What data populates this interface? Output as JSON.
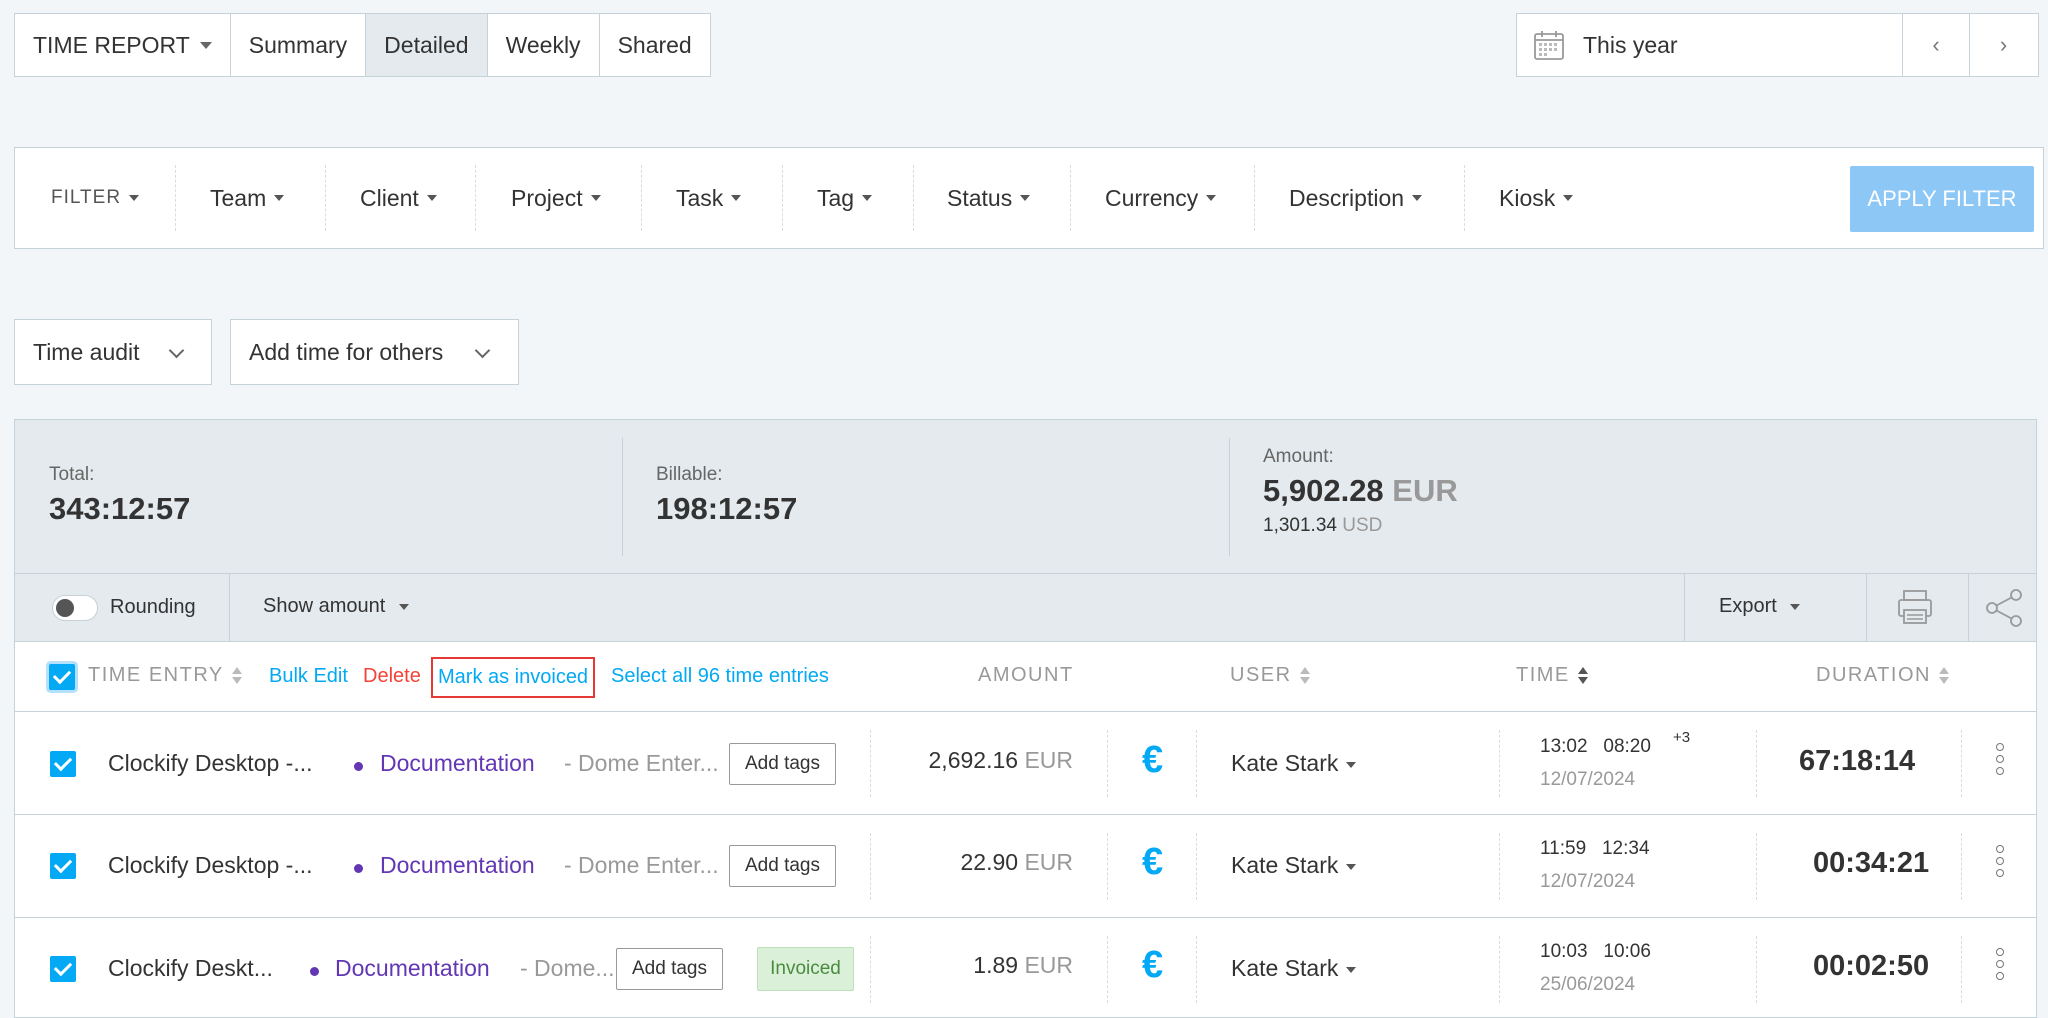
{
  "tabs": {
    "report_label": "TIME REPORT",
    "items": [
      "Summary",
      "Detailed",
      "Weekly",
      "Shared"
    ],
    "active": "Detailed"
  },
  "date_range": {
    "label": "This year",
    "prev": "‹",
    "next": "›"
  },
  "filters": {
    "label": "FILTER",
    "items": [
      "Team",
      "Client",
      "Project",
      "Task",
      "Tag",
      "Status",
      "Currency",
      "Description",
      "Kiosk"
    ],
    "apply": "APPLY FILTER"
  },
  "actions": {
    "time_audit": "Time audit",
    "add_time_others": "Add time for others"
  },
  "summary": {
    "total_label": "Total:",
    "total": "343:12:57",
    "billable_label": "Billable:",
    "billable": "198:12:57",
    "amount_label": "Amount:",
    "amount": "5,902.28",
    "amount_currency": "EUR",
    "amount_secondary": "1,301.34",
    "amount_secondary_currency": "USD"
  },
  "toolbar": {
    "rounding": "Rounding",
    "show_amount": "Show amount",
    "export": "Export"
  },
  "table": {
    "headers": {
      "time_entry": "TIME ENTRY",
      "bulk_edit": "Bulk Edit",
      "delete": "Delete",
      "mark_invoiced": "Mark as invoiced",
      "select_all": "Select all 96 time entries",
      "amount": "AMOUNT",
      "user": "USER",
      "time": "TIME",
      "duration": "DURATION"
    },
    "rows": [
      {
        "description": "Clockify Desktop -...",
        "project": "Documentation",
        "client": "- Dome Enter...",
        "tags": "Add tags",
        "amount": "2,692.16",
        "currency": "EUR",
        "user": "Kate Stark",
        "start": "13:02",
        "end": "08:20",
        "plus": "+3",
        "date": "12/07/2024",
        "duration": "67:18:14"
      },
      {
        "description": "Clockify Desktop -...",
        "project": "Documentation",
        "client": "- Dome Enter...",
        "tags": "Add tags",
        "amount": "22.90",
        "currency": "EUR",
        "user": "Kate Stark",
        "start": "11:59",
        "end": "12:34",
        "plus": "",
        "date": "12/07/2024",
        "duration": "00:34:21"
      },
      {
        "description": "Clockify Deskt...",
        "project": "Documentation",
        "client": "- Dome...",
        "tags": "Add tags",
        "status": "Invoiced",
        "amount": "1.89",
        "currency": "EUR",
        "user": "Kate Stark",
        "start": "10:03",
        "end": "10:06",
        "plus": "",
        "date": "25/06/2024",
        "duration": "00:02:50"
      }
    ]
  },
  "colors": {
    "accent": "#03a9f4",
    "project": "#6236b4",
    "delete": "#f44336",
    "apply_button": "#8cc7f5"
  },
  "icons": [
    "calendar-icon",
    "printer-icon",
    "share-icon",
    "euro-icon",
    "kebab-menu-icon"
  ]
}
